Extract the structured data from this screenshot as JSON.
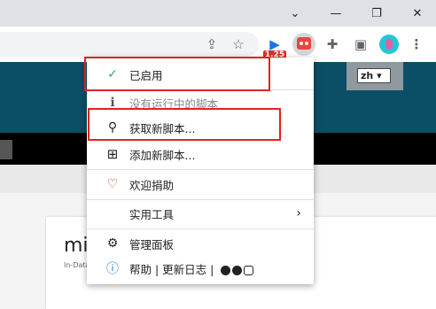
{
  "menu": {
    "enabled_label": "已启用",
    "no_scripts_label": "没有运行中的脚本",
    "get_scripts_label": "获取新脚本...",
    "add_script_label": "添加新脚本...",
    "donate_label": "欢迎捐助",
    "utilities_label": "实用工具",
    "dashboard_label": "管理面板",
    "help_label": "帮助 | 更新日志 |"
  },
  "toolbar": {
    "badge_count": "1.25"
  },
  "page": {
    "lang_value": "zh",
    "card_title": "min",
    "card_subtitle": "In-Databa"
  },
  "colors": {
    "accent_red": "#e0231b",
    "header_teal": "#0a4f66",
    "check_green": "#34a853",
    "heart_red": "#d93025"
  }
}
